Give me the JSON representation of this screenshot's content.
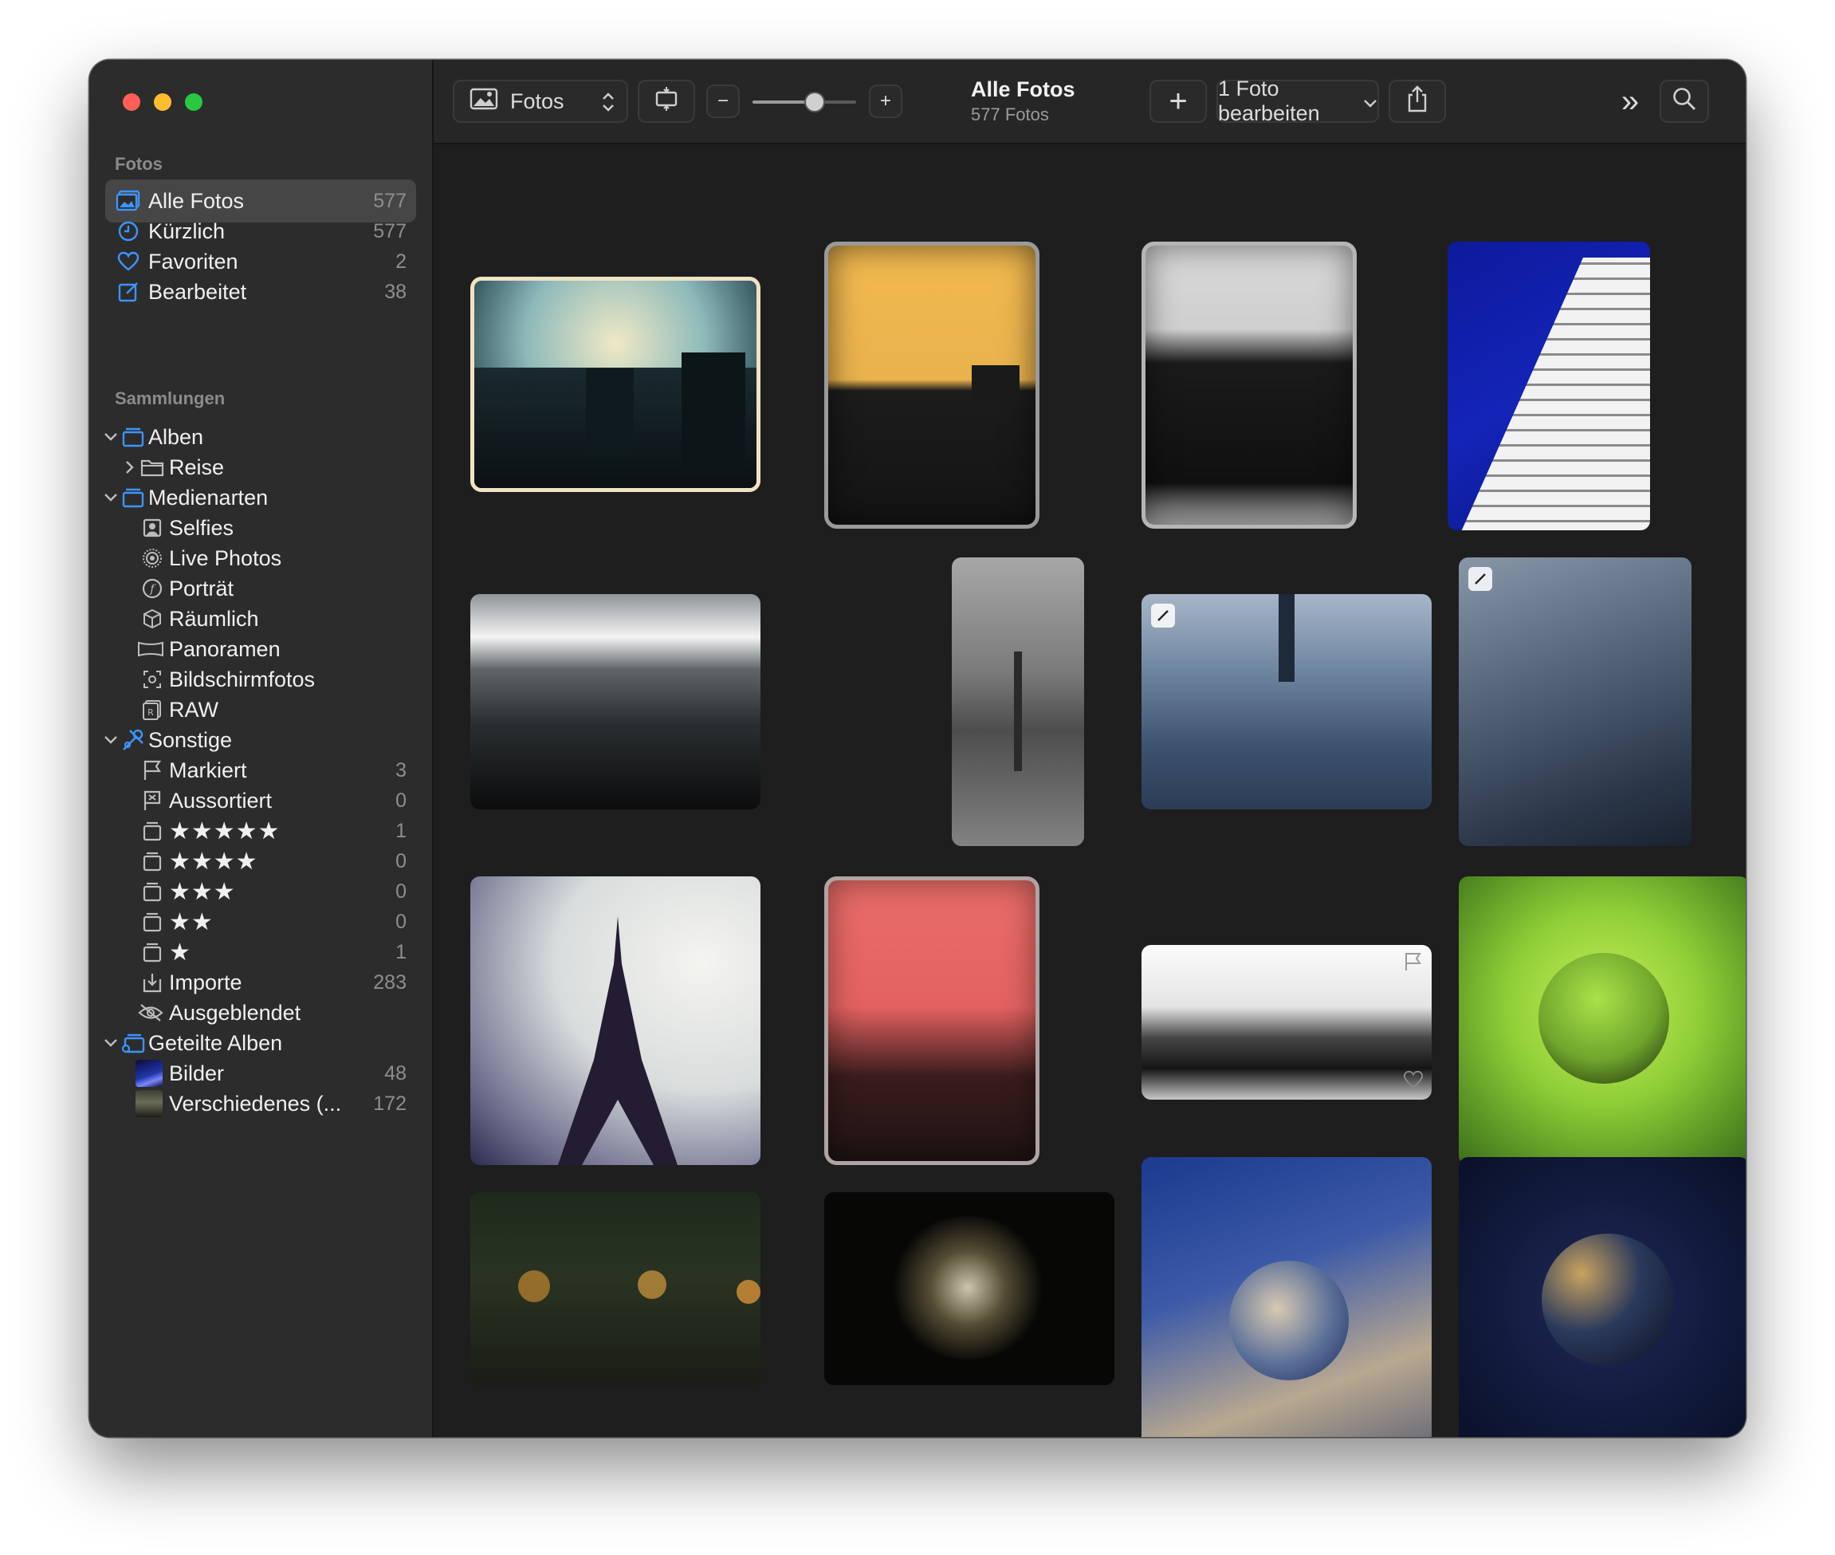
{
  "window": {
    "traffic_lights": [
      "close",
      "minimize",
      "zoom"
    ]
  },
  "sidebar": {
    "sections": [
      {
        "label": "Fotos"
      },
      {
        "label": "Sammlungen"
      }
    ],
    "library_items": [
      {
        "label": "Alle Fotos",
        "count": "577",
        "icon": "photos-icon",
        "selected": true
      },
      {
        "label": "Kürzlich",
        "count": "577",
        "icon": "clock-icon"
      },
      {
        "label": "Favoriten",
        "count": "2",
        "icon": "heart-icon"
      },
      {
        "label": "Bearbeitet",
        "count": "38",
        "icon": "edit-icon"
      }
    ],
    "collections": {
      "alben": {
        "label": "Alben",
        "children": [
          {
            "label": "Reise"
          }
        ]
      },
      "medienarten": {
        "label": "Medienarten",
        "children": [
          {
            "label": "Selfies",
            "icon": "selfie-icon"
          },
          {
            "label": "Live Photos",
            "icon": "live-photo-icon"
          },
          {
            "label": "Porträt",
            "icon": "portrait-icon"
          },
          {
            "label": "Räumlich",
            "icon": "cube-icon"
          },
          {
            "label": "Panoramen",
            "icon": "panorama-icon"
          },
          {
            "label": "Bildschirmfotos",
            "icon": "screenshot-icon"
          },
          {
            "label": "RAW",
            "icon": "raw-icon"
          }
        ]
      },
      "sonstige": {
        "label": "Sonstige",
        "children": [
          {
            "label": "Markiert",
            "count": "3",
            "icon": "flag-icon"
          },
          {
            "label": "Aussortiert",
            "count": "0",
            "icon": "reject-flag-icon"
          },
          {
            "label": "★★★★★",
            "count": "1",
            "icon": "tray-icon"
          },
          {
            "label": "★★★★",
            "count": "0",
            "icon": "tray-icon"
          },
          {
            "label": "★★★",
            "count": "0",
            "icon": "tray-icon"
          },
          {
            "label": "★★",
            "count": "0",
            "icon": "tray-icon"
          },
          {
            "label": "★",
            "count": "1",
            "icon": "tray-icon"
          },
          {
            "label": "Importe",
            "count": "283",
            "icon": "import-icon"
          },
          {
            "label": "Ausgeblendet",
            "icon": "hidden-eye-icon"
          }
        ]
      },
      "geteilte_alben": {
        "label": "Geteilte Alben",
        "children": [
          {
            "label": "Bilder",
            "count": "48"
          },
          {
            "label": "Verschiedenes (...",
            "count": "172"
          }
        ]
      }
    }
  },
  "toolbar": {
    "source_label": "Fotos",
    "zoom_minus": "−",
    "zoom_plus": "+",
    "zoom_level": 0.6,
    "title": "Alle Fotos",
    "subtitle": "577 Fotos",
    "add_label": "+",
    "edit_label": "1 Foto bearbeiten",
    "more_label": "»"
  },
  "grid": {
    "photos": [
      {
        "name": "city-sunset",
        "edited": false
      },
      {
        "name": "yellow-skyline",
        "edited": false
      },
      {
        "name": "bw-buildings",
        "edited": false
      },
      {
        "name": "blue-skyscraper",
        "edited": false
      },
      {
        "name": "metal-elevator",
        "edited": false
      },
      {
        "name": "eiffel-bw-portrait",
        "edited": false
      },
      {
        "name": "paris-panorama-blue",
        "edited": true
      },
      {
        "name": "paris-aerial",
        "edited": true
      },
      {
        "name": "eiffel-tower",
        "edited": false
      },
      {
        "name": "red-skyline",
        "edited": false
      },
      {
        "name": "bw-rooftop-panorama",
        "edited": false
      },
      {
        "name": "green-glass-sphere",
        "edited": false
      },
      {
        "name": "bokeh-lights",
        "edited": false
      },
      {
        "name": "sparkler-bokeh",
        "edited": false
      },
      {
        "name": "glass-ball-city",
        "edited": false
      },
      {
        "name": "dark-sphere",
        "edited": false
      }
    ]
  }
}
